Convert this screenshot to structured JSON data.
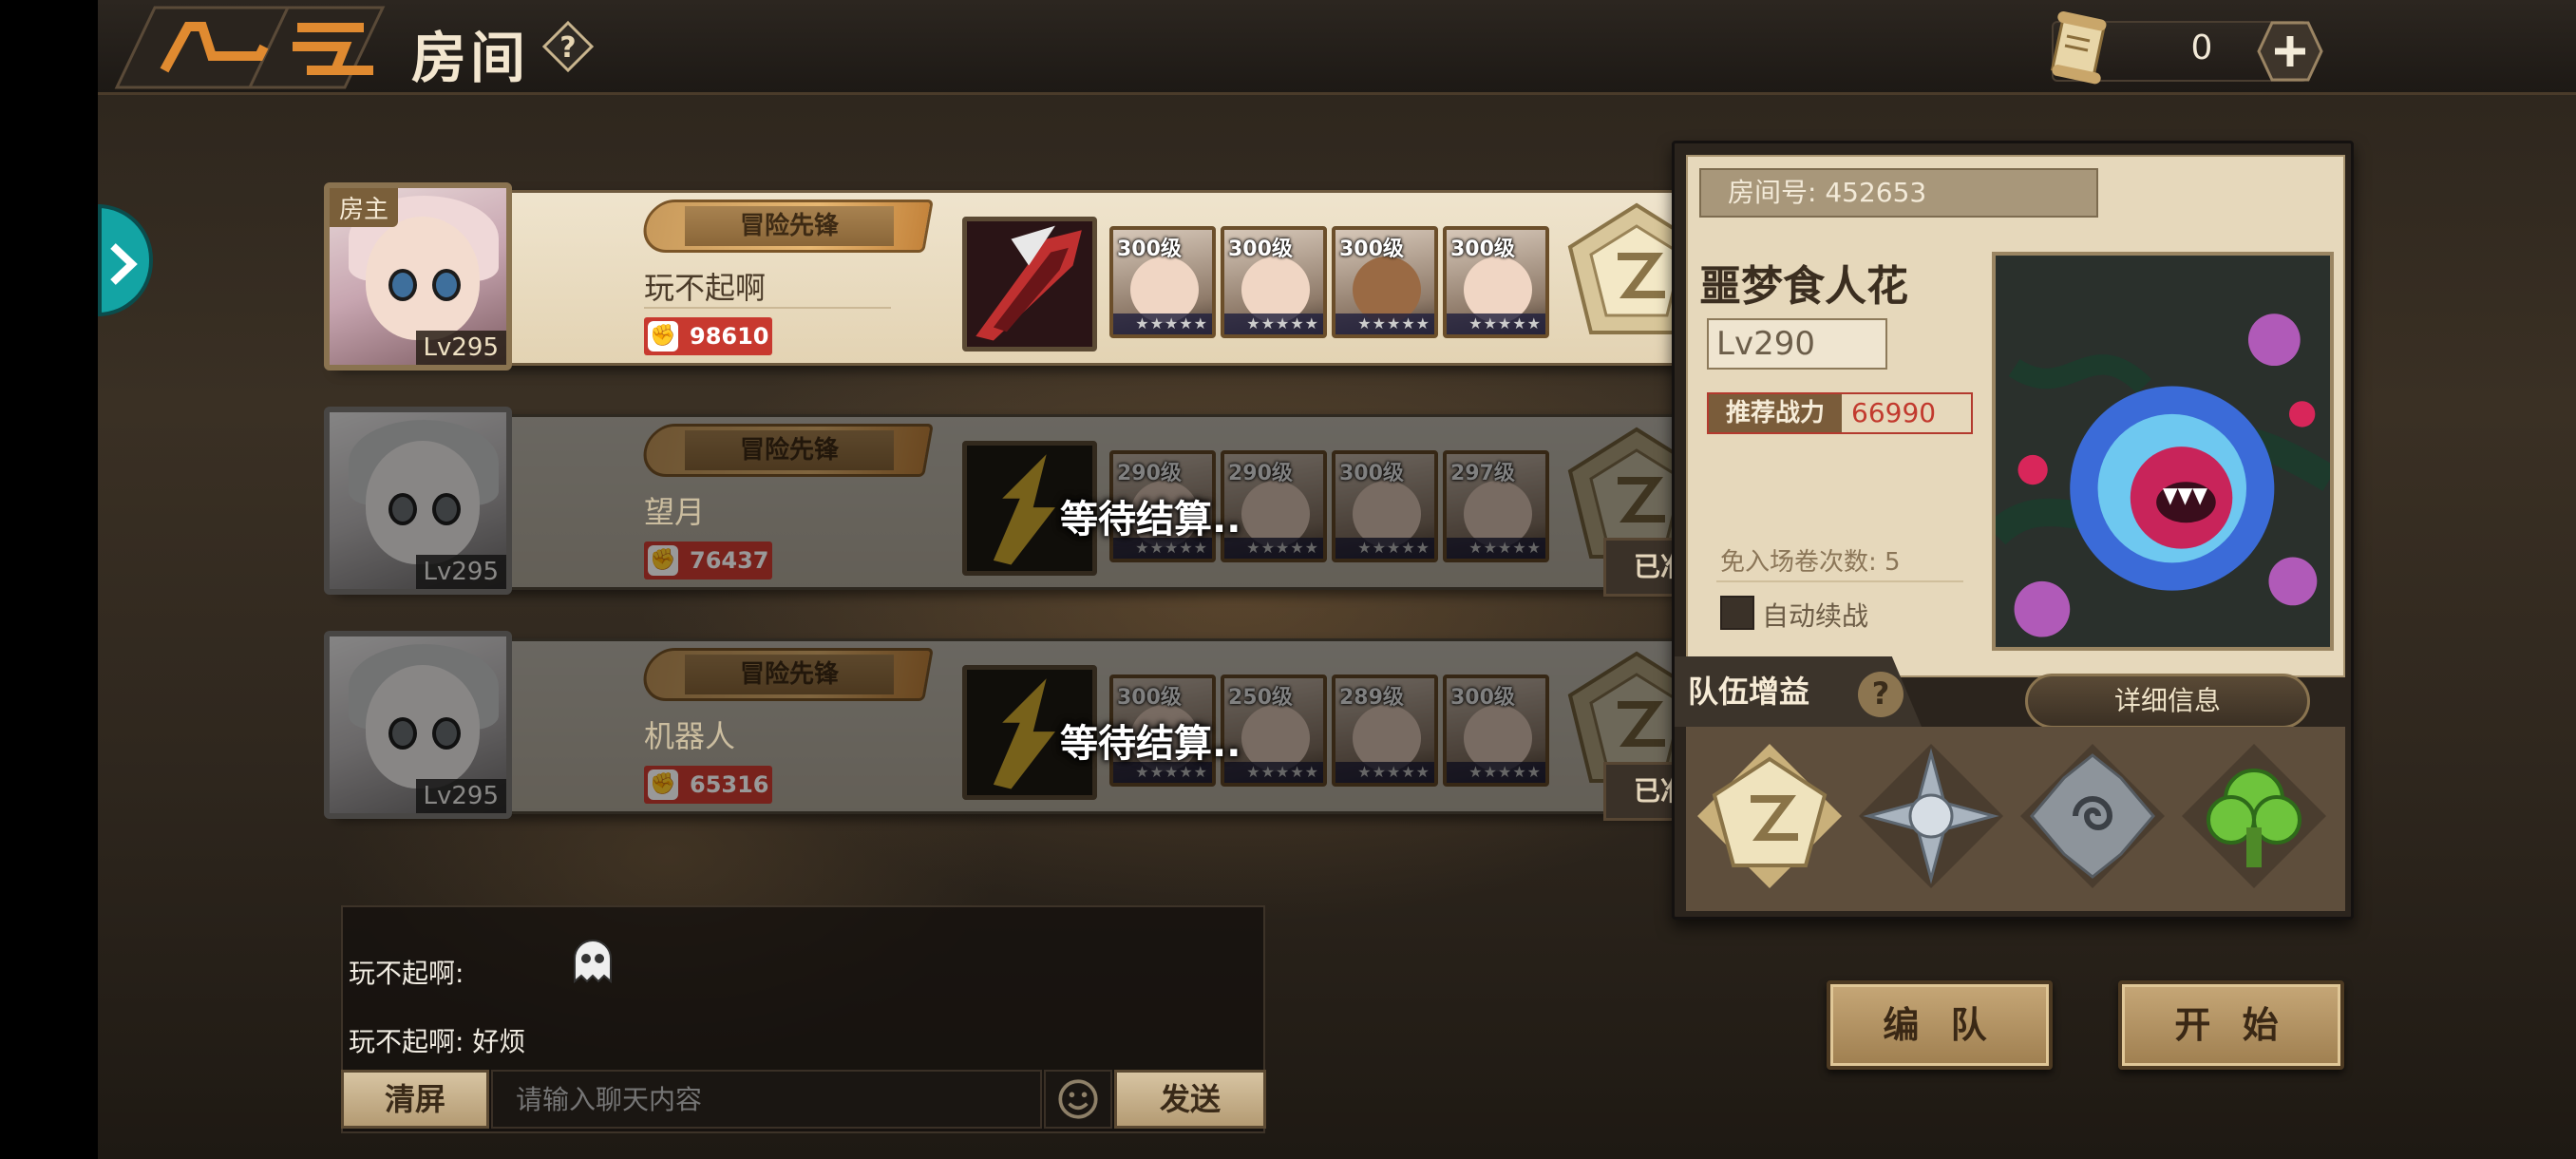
{
  "header": {
    "title": "房间",
    "help_icon": "question-icon",
    "scroll_count": "0",
    "add_icon": "plus-icon"
  },
  "players": [
    {
      "role_tag": "房主",
      "level": "Lv295",
      "title": "冒险先锋",
      "name": "玩不起啊",
      "power": "98610",
      "heroes": [
        {
          "level": "300级"
        },
        {
          "level": "300级"
        },
        {
          "level": "300级"
        },
        {
          "level": "300级"
        }
      ],
      "status": "",
      "ready": ""
    },
    {
      "role_tag": "",
      "level": "Lv295",
      "title": "冒险先锋",
      "name": "望月",
      "power": "76437",
      "heroes": [
        {
          "level": "290级"
        },
        {
          "level": "290级"
        },
        {
          "level": "300级"
        },
        {
          "level": "297级"
        }
      ],
      "status": "等待结算..",
      "ready": "已准备"
    },
    {
      "role_tag": "",
      "level": "Lv295",
      "title": "冒险先锋",
      "name": "机器人",
      "power": "65316",
      "heroes": [
        {
          "level": "300级"
        },
        {
          "level": "250级"
        },
        {
          "level": "289级"
        },
        {
          "level": "300级"
        }
      ],
      "status": "等待结算..",
      "ready": "已准备"
    }
  ],
  "chat": {
    "messages": [
      {
        "text": "玩不起啊:"
      },
      {
        "text": "玩不起啊: 好烦"
      }
    ],
    "clear_label": "清屏",
    "input_placeholder": "请输入聊天内容",
    "send_label": "发送"
  },
  "boss": {
    "room_id": "房间号: 452653",
    "name": "噩梦食人花",
    "level": "Lv290",
    "recommend_label": "推荐战力",
    "recommend_value": "66990",
    "free_entries": "免入场卷次数: 5",
    "auto_continue": "自动续战",
    "detail_label": "详细信息"
  },
  "team_bonus": {
    "label": "队伍增益",
    "icons": [
      "star-emblem-icon",
      "compass-emblem-icon",
      "spiral-emblem-icon",
      "tree-emblem-icon"
    ]
  },
  "actions": {
    "form_team": "编 队",
    "start": "开 始"
  },
  "colors": {
    "accent_gold": "#e8b872",
    "power_red": "#c8392f",
    "teal_tab": "#13a4a4",
    "bonus_green": "#6ec43c"
  }
}
